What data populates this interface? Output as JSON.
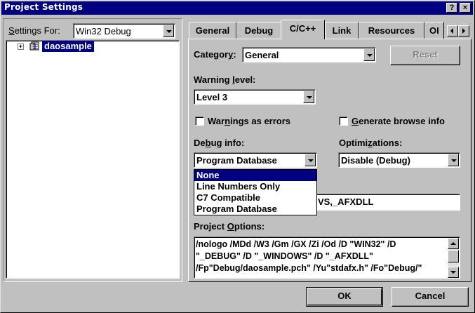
{
  "window": {
    "title": "Project Settings",
    "help_btn": "?",
    "close_btn": "×"
  },
  "left": {
    "settings_for_label": "Settings For:",
    "settings_for_value": "Win32 Debug",
    "tree_item": "daosample",
    "tree_expander": "+"
  },
  "tabs": [
    {
      "label": "General"
    },
    {
      "label": "Debug"
    },
    {
      "label": "C/C++"
    },
    {
      "label": "Link"
    },
    {
      "label": "Resources"
    },
    {
      "label": "OI"
    }
  ],
  "page": {
    "category_label": "Category:",
    "category_value": "General",
    "reset_label": "Reset",
    "warning_level_label": "Warning level:",
    "warning_level_value": "Level 3",
    "warnings_as_errors": "Warnings as errors",
    "generate_browse_info": "Generate browse info",
    "debug_info_label": "Debug info:",
    "debug_info_value": "Program Database",
    "optimizations_label": "Optimizations:",
    "optimizations_value": "Disable (Debug)",
    "preprocessor_value": "VS,_AFXDLL",
    "project_options_label": "Project Options:",
    "project_options_lines": [
      "/nologo /MDd /W3 /Gm /GX /Zi /Od /D \"WIN32\" /D",
      "\"_DEBUG\" /D \"_WINDOWS\" /D \"_AFXDLL\"",
      "/Fp\"Debug/daosample.pch\" /Yu\"stdafx.h\" /Fo\"Debug/\""
    ]
  },
  "debug_dropdown": {
    "options": [
      "None",
      "Line Numbers Only",
      "C7 Compatible",
      "Program Database"
    ],
    "highlighted": "None"
  },
  "buttons": {
    "ok": "OK",
    "cancel": "Cancel"
  },
  "colors": {
    "titlebar": "#000080",
    "face": "#c0c0c0",
    "highlight": "#000080"
  }
}
